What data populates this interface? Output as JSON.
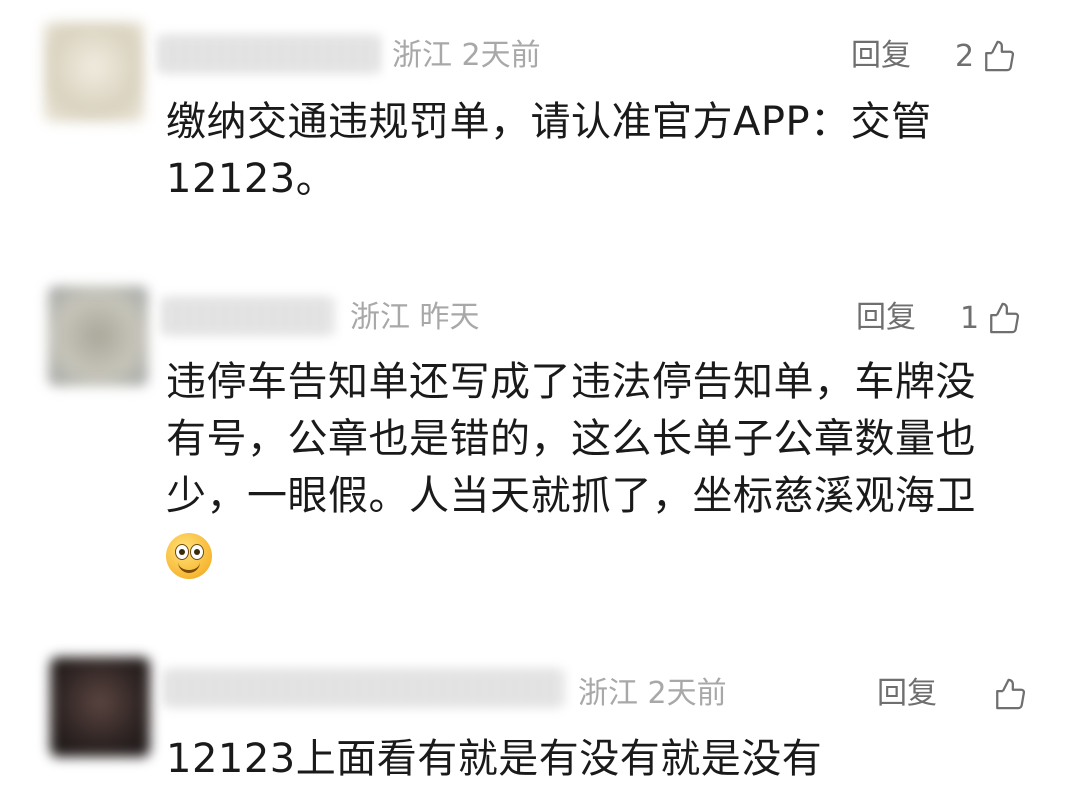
{
  "comments": [
    {
      "location": "浙江",
      "time": "2天前",
      "reply_label": "回复",
      "likes": "2",
      "text": "缴纳交通违规罚单，请认准官方APP：交管12123。",
      "avatar_color": "#e4ddc8"
    },
    {
      "location": "浙江",
      "time": "昨天",
      "reply_label": "回复",
      "likes": "1",
      "text": "违停车告知单还写成了违法停告知单，车牌没有号，公章也是错的，这么长单子公章数量也少，一眼假。人当天就抓了，坐标慈溪观海卫",
      "emoji": "smile-emoji",
      "avatar_color": "#b9b5a6"
    },
    {
      "location": "浙江",
      "time": "2天前",
      "reply_label": "回复",
      "likes": "",
      "text": "12123上面看有就是有没有就是没有",
      "avatar_color": "#3c2f2c"
    }
  ],
  "icons": {
    "like": "thumbs-up-icon"
  },
  "colors": {
    "meta": "#a8a8a8",
    "reply": "#6f6f6f",
    "text": "#1a1a1a"
  }
}
